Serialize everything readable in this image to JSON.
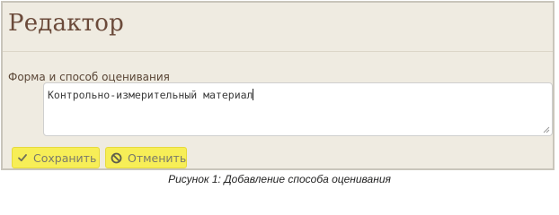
{
  "editor": {
    "title": "Редактор"
  },
  "form": {
    "field_label": "Форма и способ оценивания",
    "field_value": "Контрольно-измерительный материал"
  },
  "actions": {
    "save_label": "Сохранить",
    "save_icon": "check-icon",
    "cancel_label": "Отменить",
    "cancel_icon": "no-entry-icon",
    "button_color": "#f7ee57"
  },
  "caption": {
    "text": "Рисунок 1: Добавление способа оценивания"
  }
}
